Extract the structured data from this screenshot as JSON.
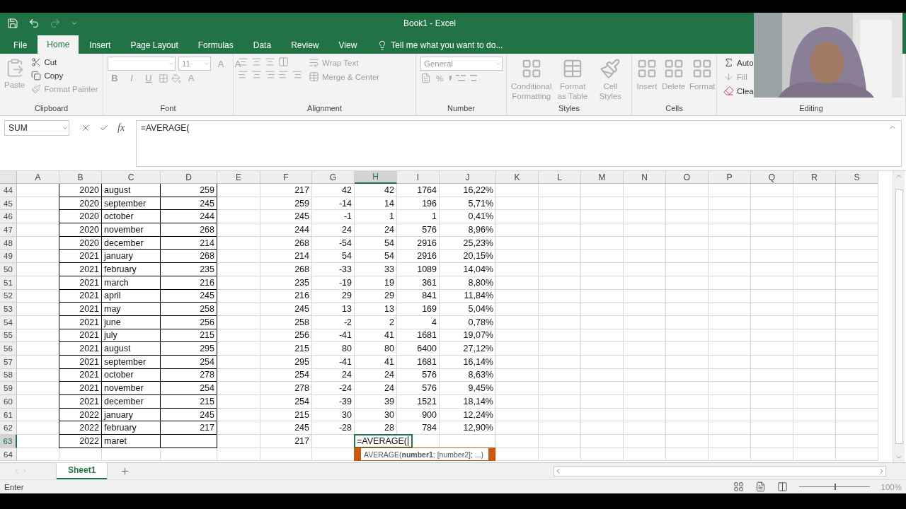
{
  "window": {
    "title": "Book1 - Excel"
  },
  "ribbon_tabs": [
    {
      "label": "File",
      "selected": false
    },
    {
      "label": "Home",
      "selected": true
    },
    {
      "label": "Insert",
      "selected": false
    },
    {
      "label": "Page Layout",
      "selected": false
    },
    {
      "label": "Formulas",
      "selected": false
    },
    {
      "label": "Data",
      "selected": false
    },
    {
      "label": "Review",
      "selected": false
    },
    {
      "label": "View",
      "selected": false
    }
  ],
  "tell_me": "Tell me what you want to do...",
  "ribbon_groups": [
    {
      "kind": "clipboard",
      "title": "Clipboard",
      "buttons": [
        {
          "label": "Paste",
          "disabled": true
        },
        {
          "label": "Cut",
          "disabled": false
        },
        {
          "label": "Copy",
          "disabled": false
        },
        {
          "label": "Format Painter",
          "disabled": true
        }
      ]
    },
    {
      "kind": "font",
      "title": "Font",
      "size": "11",
      "buttons": [
        {
          "label": "A",
          "disabled": true
        },
        {
          "label": "A",
          "disabled": true
        },
        {
          "label": "B",
          "disabled": true
        },
        {
          "label": "I",
          "disabled": true
        },
        {
          "label": "U",
          "disabled": true
        },
        {
          "label": "A",
          "disabled": true
        }
      ]
    },
    {
      "kind": "alignment",
      "title": "Alignment",
      "buttons": [
        {
          "label": "Wrap Text",
          "disabled": true
        },
        {
          "label": "Merge & Center",
          "disabled": true
        }
      ]
    },
    {
      "kind": "number",
      "title": "Number",
      "format": "General",
      "buttons": [
        {
          "label": "%",
          "disabled": true
        }
      ]
    },
    {
      "kind": "styles",
      "title": "Styles",
      "buttons": [
        {
          "label": "Conditional Formatting",
          "disabled": true
        },
        {
          "label": "Format as Table",
          "disabled": true
        },
        {
          "label": "Cell Styles",
          "disabled": true
        }
      ]
    },
    {
      "kind": "cells",
      "title": "Cells",
      "buttons": [
        {
          "label": "Insert",
          "disabled": true
        },
        {
          "label": "Delete",
          "disabled": true
        },
        {
          "label": "Format",
          "disabled": true
        }
      ]
    },
    {
      "kind": "editing",
      "title": "Editing",
      "buttons": [
        {
          "label": "Auto",
          "disabled": false
        },
        {
          "label": "Fill",
          "disabled": true
        },
        {
          "label": "Clea",
          "disabled": false
        }
      ]
    }
  ],
  "formula_bar": {
    "name_box": "SUM",
    "fx": "fx",
    "formula": "=AVERAGE("
  },
  "columns": [
    {
      "label": "A",
      "kind": "number",
      "bordered": false,
      "selected": false
    },
    {
      "label": "B",
      "kind": "number",
      "bordered": true,
      "selected": false
    },
    {
      "label": "C",
      "kind": "text",
      "bordered": true,
      "selected": false
    },
    {
      "label": "D",
      "kind": "number",
      "bordered": true,
      "selected": false
    },
    {
      "label": "E",
      "kind": "number",
      "bordered": false,
      "selected": false
    },
    {
      "label": "F",
      "kind": "number",
      "bordered": false,
      "selected": false
    },
    {
      "label": "G",
      "kind": "number",
      "bordered": false,
      "selected": false
    },
    {
      "label": "H",
      "kind": "number",
      "bordered": false,
      "selected": true
    },
    {
      "label": "I",
      "kind": "number",
      "bordered": false,
      "selected": false
    },
    {
      "label": "J",
      "kind": "number",
      "bordered": false,
      "selected": false
    },
    {
      "label": "K",
      "kind": "number",
      "bordered": false,
      "selected": false
    },
    {
      "label": "L",
      "kind": "number",
      "bordered": false,
      "selected": false
    },
    {
      "label": "M",
      "kind": "number",
      "bordered": false,
      "selected": false
    },
    {
      "label": "N",
      "kind": "number",
      "bordered": false,
      "selected": false
    },
    {
      "label": "O",
      "kind": "number",
      "bordered": false,
      "selected": false
    },
    {
      "label": "P",
      "kind": "number",
      "bordered": false,
      "selected": false
    },
    {
      "label": "Q",
      "kind": "number",
      "bordered": false,
      "selected": false
    },
    {
      "label": "R",
      "kind": "number",
      "bordered": false,
      "selected": false
    },
    {
      "label": "S",
      "kind": "number",
      "bordered": false,
      "selected": false
    }
  ],
  "rows": [
    {
      "number": "44",
      "selected": false,
      "cells": [
        null,
        "2020",
        "august",
        "259",
        null,
        "217",
        "42",
        "42",
        "1764",
        "16,22%"
      ]
    },
    {
      "number": "45",
      "selected": false,
      "cells": [
        null,
        "2020",
        "september",
        "245",
        null,
        "259",
        "-14",
        "14",
        "196",
        "5,71%"
      ]
    },
    {
      "number": "46",
      "selected": false,
      "cells": [
        null,
        "2020",
        "october",
        "244",
        null,
        "245",
        "-1",
        "1",
        "1",
        "0,41%"
      ]
    },
    {
      "number": "47",
      "selected": false,
      "cells": [
        null,
        "2020",
        "november",
        "268",
        null,
        "244",
        "24",
        "24",
        "576",
        "8,96%"
      ]
    },
    {
      "number": "48",
      "selected": false,
      "cells": [
        null,
        "2020",
        "december",
        "214",
        null,
        "268",
        "-54",
        "54",
        "2916",
        "25,23%"
      ]
    },
    {
      "number": "49",
      "selected": false,
      "cells": [
        null,
        "2021",
        "january",
        "268",
        null,
        "214",
        "54",
        "54",
        "2916",
        "20,15%"
      ]
    },
    {
      "number": "50",
      "selected": false,
      "cells": [
        null,
        "2021",
        "february",
        "235",
        null,
        "268",
        "-33",
        "33",
        "1089",
        "14,04%"
      ]
    },
    {
      "number": "51",
      "selected": false,
      "cells": [
        null,
        "2021",
        "march",
        "216",
        null,
        "235",
        "-19",
        "19",
        "361",
        "8,80%"
      ]
    },
    {
      "number": "52",
      "selected": false,
      "cells": [
        null,
        "2021",
        "april",
        "245",
        null,
        "216",
        "29",
        "29",
        "841",
        "11,84%"
      ]
    },
    {
      "number": "53",
      "selected": false,
      "cells": [
        null,
        "2021",
        "may",
        "258",
        null,
        "245",
        "13",
        "13",
        "169",
        "5,04%"
      ]
    },
    {
      "number": "54",
      "selected": false,
      "cells": [
        null,
        "2021",
        "june",
        "256",
        null,
        "258",
        "-2",
        "2",
        "4",
        "0,78%"
      ]
    },
    {
      "number": "55",
      "selected": false,
      "cells": [
        null,
        "2021",
        "july",
        "215",
        null,
        "256",
        "-41",
        "41",
        "1681",
        "19,07%"
      ]
    },
    {
      "number": "56",
      "selected": false,
      "cells": [
        null,
        "2021",
        "august",
        "295",
        null,
        "215",
        "80",
        "80",
        "6400",
        "27,12%"
      ]
    },
    {
      "number": "57",
      "selected": false,
      "cells": [
        null,
        "2021",
        "september",
        "254",
        null,
        "295",
        "-41",
        "41",
        "1681",
        "16,14%"
      ]
    },
    {
      "number": "58",
      "selected": false,
      "cells": [
        null,
        "2021",
        "october",
        "278",
        null,
        "254",
        "24",
        "24",
        "576",
        "8,63%"
      ]
    },
    {
      "number": "59",
      "selected": false,
      "cells": [
        null,
        "2021",
        "november",
        "254",
        null,
        "278",
        "-24",
        "24",
        "576",
        "9,45%"
      ]
    },
    {
      "number": "60",
      "selected": false,
      "cells": [
        null,
        "2021",
        "december",
        "215",
        null,
        "254",
        "-39",
        "39",
        "1521",
        "18,14%"
      ]
    },
    {
      "number": "61",
      "selected": false,
      "cells": [
        null,
        "2022",
        "january",
        "245",
        null,
        "215",
        "30",
        "30",
        "900",
        "12,24%"
      ]
    },
    {
      "number": "62",
      "selected": false,
      "cells": [
        null,
        "2022",
        "february",
        "217",
        null,
        "245",
        "-28",
        "28",
        "784",
        "12,90%"
      ]
    },
    {
      "number": "63",
      "selected": true,
      "cells": [
        null,
        "2022",
        "maret",
        null,
        null,
        "217"
      ]
    },
    {
      "number": "64",
      "selected": false
    }
  ],
  "edit_cell": {
    "text": "=AVERAGE(",
    "tooltip": "AVERAGE(**number1**; [number2]; ...)"
  },
  "sheet_tabs": [
    {
      "label": "Sheet1",
      "selected": true
    }
  ],
  "status_bar": {
    "mode": "Enter",
    "zoom": "100%",
    "zoom_level": {
      "level": 0.5
    }
  }
}
